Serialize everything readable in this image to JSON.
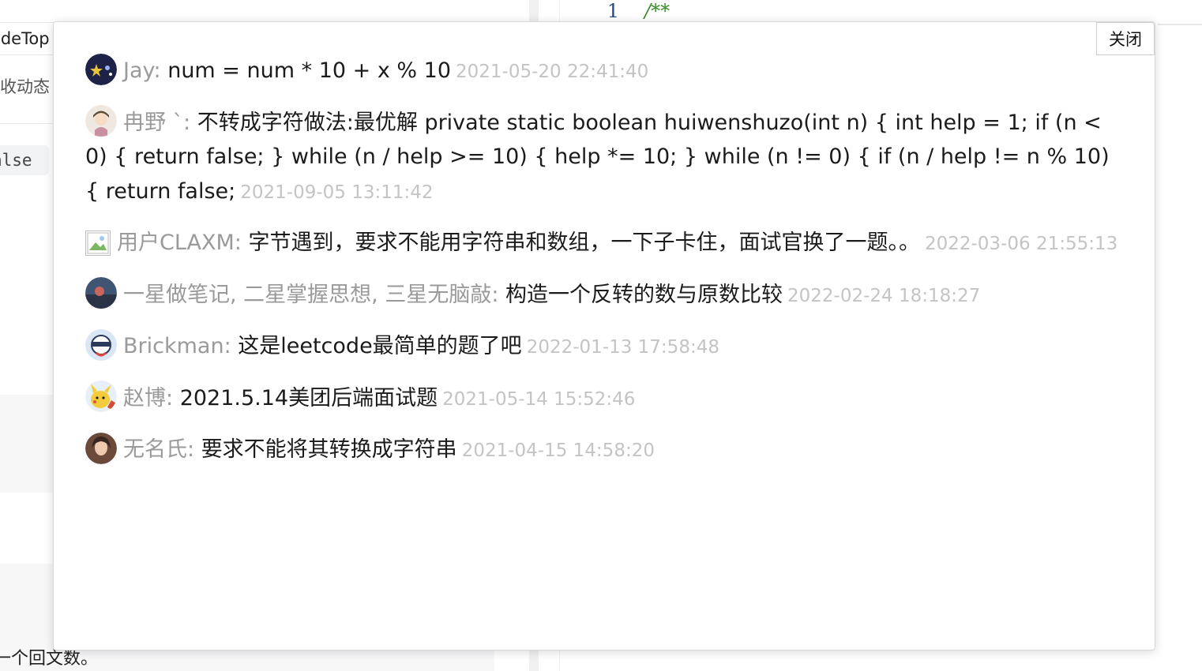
{
  "background": {
    "left_title": "odeTop",
    "left_subtitle": "收动态",
    "code_chip": "alse",
    "bottom_text": "一个回文数。",
    "editor": {
      "line_number": "1",
      "code_text": "/**"
    }
  },
  "modal": {
    "close_label": "关闭",
    "comments": [
      {
        "avatar": "dark-star-avatar",
        "author": "Jay: ",
        "text": "num = num * 10 + x % 10",
        "time": "2021-05-20 22:41:40",
        "avatar_color": "#1e2246"
      },
      {
        "avatar": "girl-avatar",
        "author": "冉野 `: ",
        "text": "不转成字符做法:最优解 private static boolean huiwenshuzo(int n) { int help = 1; if (n < 0) { return false; } while (n / help >= 10) { help *= 10; } while (n != 0) { if (n / help != n % 10) { return false;",
        "time": "2021-09-05 13:11:42",
        "avatar_color": "#efe8e0"
      },
      {
        "avatar": "broken-image-avatar",
        "author": "用户CLAXM: ",
        "text": "字节遇到，要求不能用字符串和数组，一下子卡住，面试官换了一题。。",
        "time": "2022-03-06 21:55:13",
        "avatar_color": "#ffffff"
      },
      {
        "avatar": "photo-avatar",
        "author": "一星做笔记, 二星掌握思想, 三星无脑敲: ",
        "text": "构造一个反转的数与原数比较",
        "time": "2022-02-24 18:18:27",
        "avatar_color": "#3f5573"
      },
      {
        "avatar": "cartoon-avatar",
        "author": "Brickman: ",
        "text": "这是leetcode最简单的题了吧",
        "time": "2022-01-13 17:58:48",
        "avatar_color": "#dbe6f5"
      },
      {
        "avatar": "pikachu-avatar",
        "author": "赵博: ",
        "text": "2021.5.14美团后端面试题",
        "time": "2021-05-14 15:52:46",
        "avatar_color": "#f2cc3a"
      },
      {
        "avatar": "portrait-avatar",
        "author": "无名氏: ",
        "text": "要求不能将其转换成字符串",
        "time": "2021-04-15 14:58:20",
        "avatar_color": "#6b4a3c"
      }
    ]
  }
}
